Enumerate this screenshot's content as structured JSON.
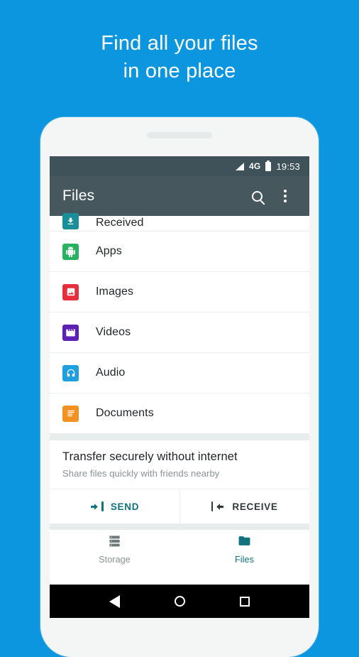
{
  "headline": {
    "line1": "Find all your files",
    "line2": "in one place"
  },
  "colors": {
    "background": "#0d96e0",
    "app_bar": "#46575e",
    "status_bar": "#3f5259",
    "accent_teal": "#10737f",
    "frame": "#f4f6f6"
  },
  "status_bar": {
    "signal_icon": "signal-triangle-icon",
    "network": "4G",
    "battery_icon": "battery-icon",
    "time": "19:53"
  },
  "app_bar": {
    "title": "Files",
    "search_icon": "search-icon",
    "overflow_icon": "overflow-menu-icon"
  },
  "file_list": [
    {
      "label": "Received",
      "icon": "download-inbox-icon",
      "color": "#1a8f99",
      "clipped": true
    },
    {
      "label": "Apps",
      "icon": "android-robot-icon",
      "color": "#27b161",
      "clipped": false
    },
    {
      "label": "Images",
      "icon": "photo-icon",
      "color": "#e52f3a",
      "clipped": false
    },
    {
      "label": "Videos",
      "icon": "clapperboard-icon",
      "color": "#5d20b5",
      "clipped": false
    },
    {
      "label": "Audio",
      "icon": "headphones-icon",
      "color": "#1e9fe0",
      "clipped": false
    },
    {
      "label": "Documents",
      "icon": "document-icon",
      "color": "#f29022",
      "clipped": false
    }
  ],
  "transfer": {
    "title": "Transfer securely without internet",
    "subtitle": "Share files quickly with friends nearby",
    "send_label": "SEND",
    "send_icon": "arrow-right-to-bar-icon",
    "receive_label": "RECEIVE",
    "receive_icon": "arrow-left-to-bar-icon"
  },
  "bottom_nav": [
    {
      "label": "Storage",
      "icon": "storage-server-icon",
      "active": false
    },
    {
      "label": "Files",
      "icon": "folder-icon",
      "active": true
    }
  ],
  "system_nav": {
    "back": "back-triangle-icon",
    "home": "home-circle-icon",
    "recents": "recents-square-icon"
  }
}
